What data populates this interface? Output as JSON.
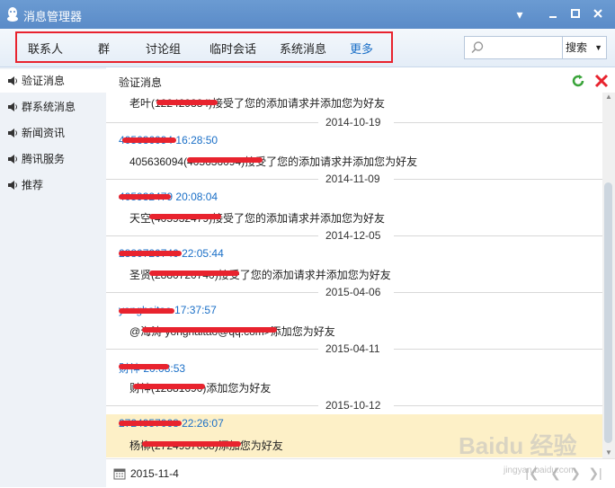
{
  "window": {
    "title": "消息管理器"
  },
  "nav": {
    "tabs": [
      "联系人",
      "群",
      "讨论组",
      "临时会话",
      "系统消息",
      "更多"
    ]
  },
  "search": {
    "placeholder": "",
    "button_label": "搜索"
  },
  "sidebar": {
    "items": [
      {
        "label": "验证消息"
      },
      {
        "label": "群系统消息"
      },
      {
        "label": "新闻资讯"
      },
      {
        "label": "腾讯服务"
      },
      {
        "label": "推荐"
      }
    ]
  },
  "content": {
    "header": "验证消息",
    "messages": [
      {
        "time": "",
        "text": "老叶(122429884)接受了您的添加请求并添加您为好友"
      },
      {
        "date": "2014-10-19"
      },
      {
        "time": "405636094 16:28:50",
        "text": "405636094(405636094)接受了您的添加请求并添加您为好友"
      },
      {
        "date": "2014-11-09"
      },
      {
        "time": "405932479 20:08:04",
        "text": "天空(405932479)接受了您的添加请求并添加您为好友"
      },
      {
        "date": "2014-12-05"
      },
      {
        "time": "2880720740 22:05:44",
        "text": "圣贤(2880720740)接受了您的添加请求并添加您为好友"
      },
      {
        "date": "2015-04-06"
      },
      {
        "time": "yonghaitao 17:37:57",
        "text": "@海涛 yonghaitao@qq.com>添加您为好友"
      },
      {
        "date": "2015-04-11"
      },
      {
        "time": "财神 20:08:53",
        "text": "财神(12881690)添加您为好友"
      },
      {
        "date": "2015-10-12"
      },
      {
        "time": "2724957068 22:26:07",
        "text": "杨柳(2724957068)添加您为好友"
      }
    ]
  },
  "footer": {
    "date": "2015-11-4"
  },
  "watermark": {
    "main": "Baidu 经验",
    "sub": "jingyan.baidu.com"
  },
  "colors": {
    "accent": "#1a6fc7",
    "titlebar": "#5a8bc8",
    "redact": "#e8232e",
    "highlight": "#fdf0c7"
  }
}
